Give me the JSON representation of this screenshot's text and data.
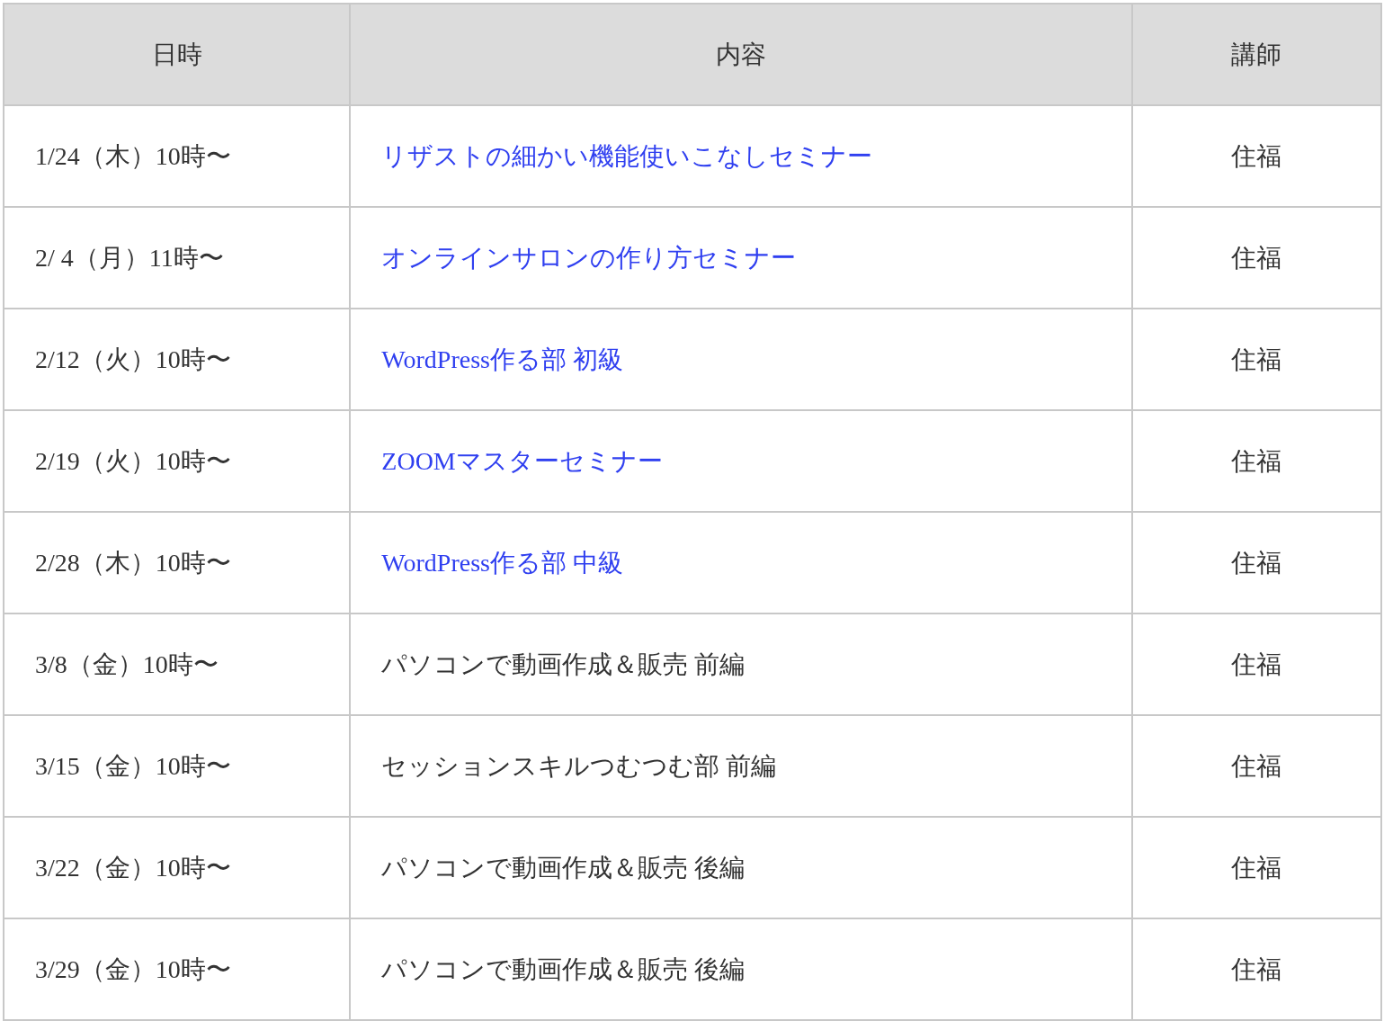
{
  "table": {
    "columns": [
      "日時",
      "内容",
      "講師"
    ],
    "rows": [
      {
        "date": "1/24（木）10時〜",
        "content": "リザストの細かい機能使いこなしセミナー",
        "kind": "link",
        "teacher": "住福"
      },
      {
        "date": "2/ 4（月）11時〜",
        "content": "オンラインサロンの作り方セミナー",
        "kind": "link",
        "teacher": "住福"
      },
      {
        "date": "2/12（火）10時〜",
        "content": "WordPress作る部 初級",
        "kind": "link",
        "teacher": "住福"
      },
      {
        "date": "2/19（火）10時〜",
        "content": "ZOOMマスターセミナー",
        "kind": "link",
        "teacher": "住福"
      },
      {
        "date": "2/28（木）10時〜",
        "content": "WordPress作る部 中級",
        "kind": "link",
        "teacher": "住福"
      },
      {
        "date": "3/8（金）10時〜",
        "content": "パソコンで動画作成＆販売 前編",
        "kind": "text",
        "teacher": "住福"
      },
      {
        "date": "3/15（金）10時〜",
        "content": "セッションスキルつむつむ部 前編",
        "kind": "text",
        "teacher": "住福"
      },
      {
        "date": "3/22（金）10時〜",
        "content": "パソコンで動画作成＆販売 後編",
        "kind": "text",
        "teacher": "住福"
      },
      {
        "date": "3/29（金）10時〜",
        "content": "パソコンで動画作成＆販売 後編",
        "kind": "text",
        "teacher": "住福"
      }
    ]
  }
}
